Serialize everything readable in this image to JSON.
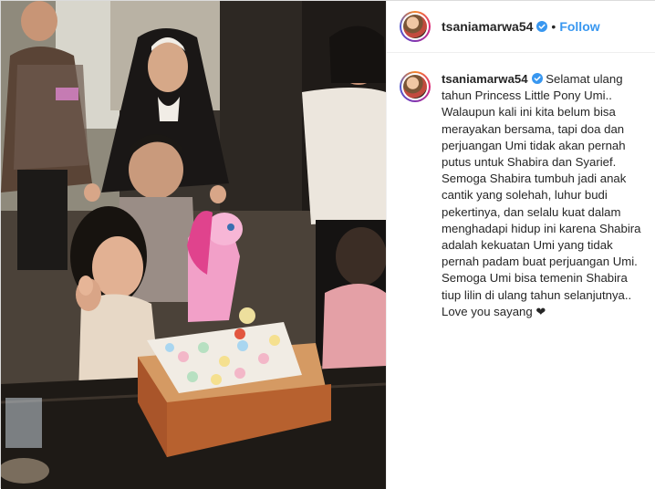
{
  "post": {
    "username": "tsaniamarwa54",
    "verified": true,
    "separator": "•",
    "follow_label": "Follow"
  },
  "caption": {
    "username": "tsaniamarwa54",
    "text": "Selamat ulang tahun Princess Little Pony Umi.. Walaupun kali ini kita belum bisa merayakan bersama, tapi doa dan perjuangan Umi tidak akan pernah putus untuk Shabira dan Syarief. Semoga Shabira tumbuh jadi anak cantik yang solehah, luhur budi pekertinya, dan selalu kuat dalam menghadapi hidup ini karena Shabira adalah kekuatan Umi yang tidak pernah padam buat perjuangan Umi. Semoga Umi bisa temenin Shabira tiup lilin di ulang tahun selanjutnya.. Love you sayang ❤"
  },
  "colors": {
    "link_blue": "#3897f0",
    "verified_blue": "#3897f0",
    "border": "#dbdbdb",
    "text": "#262626"
  },
  "icons": {
    "verified": "verified-badge-icon",
    "heart": "heart-emoji"
  }
}
